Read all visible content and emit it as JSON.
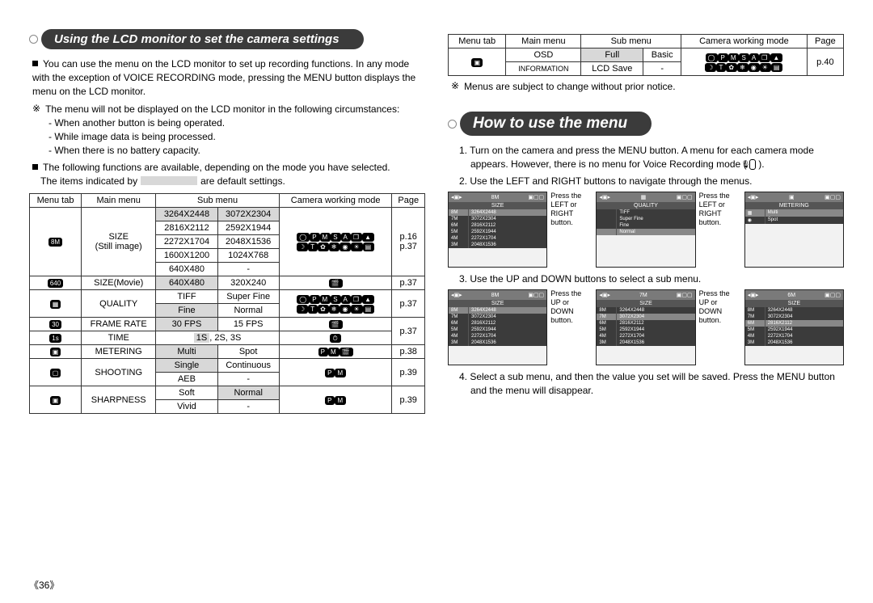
{
  "pageNumber": "《36》",
  "left": {
    "title": "Using the LCD monitor to set the camera settings",
    "intro": "You can use the menu on the LCD monitor to set up recording functions. In any mode with the exception of VOICE RECORDING mode, pressing the MENU button displays the menu on the LCD monitor.",
    "noteLead": "The menu will not be displayed on the LCD monitor in the following circumstances:",
    "noteItems": [
      "- When another button is being operated.",
      "- While image data is being processed.",
      "- When there is no battery capacity."
    ],
    "availLead": "The following functions are available, depending on the mode you have selected.",
    "defaultLead1": "The items indicated by",
    "defaultLead2": "are default settings.",
    "tableHead": [
      "Menu tab",
      "Main menu",
      "Sub menu",
      "",
      "Camera working mode",
      "Page"
    ],
    "rows": {
      "size_label": "SIZE\n(Still image)",
      "size1a": "3264X2448",
      "size1b": "3072X2304",
      "size2a": "2816X2112",
      "size2b": "2592X1944",
      "size3a": "2272X1704",
      "size3b": "2048X1536",
      "size4a": "1600X1200",
      "size4b": "1024X768",
      "size5a": "640X480",
      "size5b": "-",
      "size_page": "p.16\np.37",
      "sizem_label": "SIZE(Movie)",
      "sizem_a": "640X480",
      "sizem_b": "320X240",
      "sizem_page": "p.37",
      "qual_label": "QUALITY",
      "qual1a": "TIFF",
      "qual1b": "Super Fine",
      "qual2a": "Fine",
      "qual2b": "Normal",
      "qual_page": "p.37",
      "fr_label": "FRAME RATE",
      "fr_a": "30 FPS",
      "fr_b": "15 FPS",
      "time_label": "TIME",
      "time_sub": "1S, 2S, 3S",
      "frtime_page": "p.37",
      "met_label": "METERING",
      "met_a": "Multi",
      "met_b": "Spot",
      "met_page": "p.38",
      "shoot_label": "SHOOTING",
      "shoot1a": "Single",
      "shoot1b": "Continuous",
      "shoot2a": "AEB",
      "shoot2b": "-",
      "shoot_page": "p.39",
      "sharp_label": "SHARPNESS",
      "sharp1a": "Soft",
      "sharp1b": "Normal",
      "sharp2a": "Vivid",
      "sharp2b": "-",
      "sharp_page": "p.39"
    }
  },
  "right": {
    "smallTable": {
      "head": [
        "Menu tab",
        "Main menu",
        "Sub menu",
        "",
        "Camera working mode",
        "Page"
      ],
      "r1_main": "OSD",
      "r1_a": "Full",
      "r1_b": "Basic",
      "r2_main": "INFORMATION",
      "r2_a": "LCD Save",
      "r2_b": "-",
      "page": "p.40"
    },
    "changeNotice": "Menus are subject to change without prior notice.",
    "title": "How to use the menu",
    "step1": "1. Turn on the camera and press the MENU button. A menu for each camera mode appears. However, there is no menu for Voice Recording mode (        ).",
    "step2": "2. Use the LEFT and RIGHT buttons to navigate through the menus.",
    "step3": "3. Use the UP and DOWN buttons to select a sub menu.",
    "step4": "4. Select a sub menu, and then the value you set will be saved. Press the MENU button and the menu will disappear.",
    "cap1": "Press the LEFT or RIGHT button.",
    "cap2": "Press the UP or DOWN button.",
    "screens": {
      "size_title": "SIZE",
      "quality_title": "QUALITY",
      "metering_title": "METERING",
      "sizes": [
        "3264X2448",
        "3072X2304",
        "2816X2112",
        "2592X1944",
        "2272X1704",
        "2048X1536"
      ],
      "qualities": [
        "TIFF",
        "Super Fine",
        "Fine",
        "Normal"
      ],
      "metering": [
        "Multi",
        "Spot"
      ],
      "left_labels": [
        "8M",
        "7M",
        "6M",
        "5M",
        "4M",
        "3M"
      ]
    }
  }
}
